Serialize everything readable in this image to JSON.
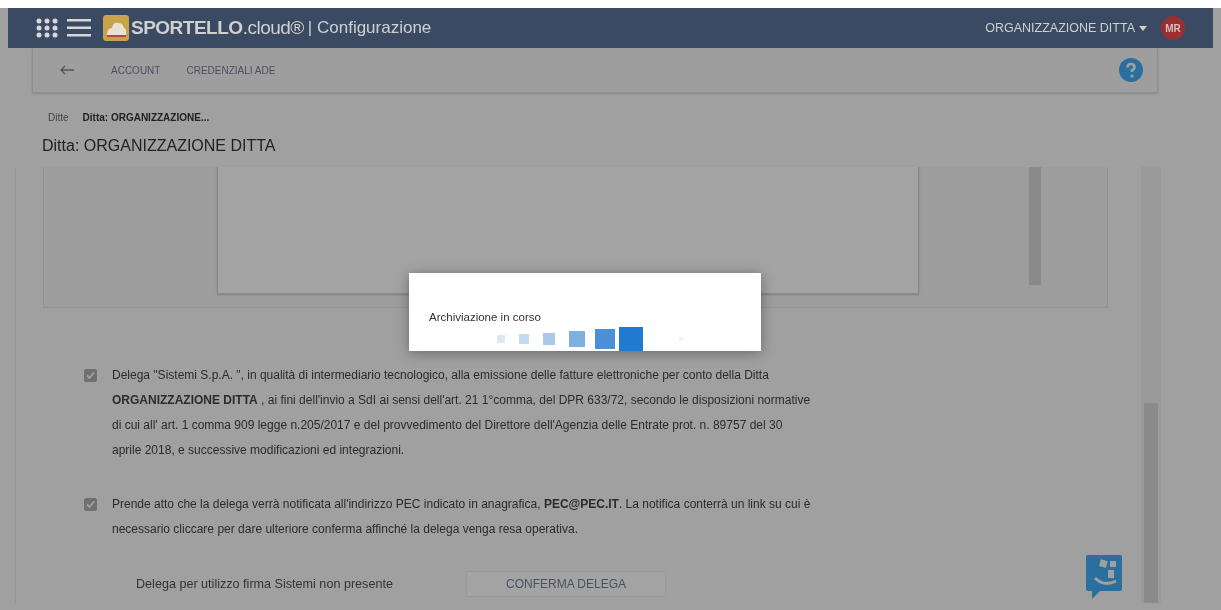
{
  "header": {
    "brand": "SPORTELLO",
    "brand_suffix": ".cloud®",
    "section": "| Configurazione",
    "organization": "ORGANIZZAZIONE DITTA",
    "avatar_initials": "MR"
  },
  "subnav": {
    "tabs": [
      {
        "label": "ACCOUNT"
      },
      {
        "label": "CREDENZIALI ADE"
      }
    ]
  },
  "breadcrumb": [
    "Ditte",
    "Ditta: ORGANIZZAZIONE..."
  ],
  "page_title": "Ditta: ORGANIZZAZIONE DITTA",
  "consents": [
    {
      "checked": true,
      "text": "Delega \"Sistemi S.p.A. \", in qualità di intermediario tecnologico, alla emissione delle fatture elettroniche per conto della Ditta **ORGANIZZAZIONE DITTA** , ai fini dell'invio a SdI ai sensi dell'art. 21 1°comma, del DPR 633/72, secondo le disposizioni normative di cui all' art. 1 comma 909 legge n.205/2017 e del provvedimento del Direttore dell'Agenzia delle Entrate prot. n. 89757 del 30 aprile 2018, e successive modificazioni ed integrazioni."
    },
    {
      "checked": true,
      "text": "Prende atto che la delega verrà notificata all'indirizzo PEC indicato in anagrafica, **PEC@PEC.IT**. La notifica conterrà un link su cui è necessario cliccare per dare ulteriore conferma affinché la delega venga resa operativa."
    }
  ],
  "signature_status": "Delega per utilizzo firma Sistemi non presente",
  "confirm_button": "CONFERMA DELEGA",
  "dialog": {
    "message": "Archiviazione in corso"
  }
}
